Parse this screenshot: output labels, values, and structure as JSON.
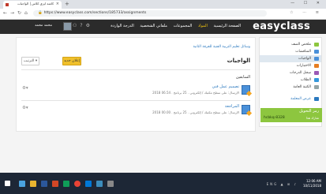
{
  "browser": {
    "tab_title": "كاشة ايزي كلاس | الواجبات",
    "new_tab": "+",
    "tab_close": "×",
    "window_controls": "—  ☐  ✕",
    "nav_back": "←",
    "nav_forward": "→",
    "nav_reload": "↻",
    "nav_home": "⌂",
    "url": "https://www.easyclass.com/sections/185733/assignments",
    "tools": "☆  ⋯  ≡"
  },
  "header": {
    "logo": "easyclass",
    "nav": [
      "الصفحة الرئيسية",
      "المواد",
      "المجموعات",
      "ملفاتي الشخصية",
      "الدرجة الواردة"
    ],
    "active_nav": 1,
    "user_name": "محمد محمد"
  },
  "sidebar": {
    "items": [
      {
        "label": "ملخص الصف",
        "icon": "home-icon",
        "color": "#8dc63f"
      },
      {
        "label": "المناقشات",
        "icon": "chat-icon",
        "color": "#4a90d9"
      },
      {
        "label": "الواجبات",
        "icon": "assignment-icon",
        "color": "#4a90d9"
      },
      {
        "label": "الاختبارات",
        "icon": "quiz-icon",
        "color": "#e67e22"
      },
      {
        "label": "سجل الدرجات",
        "icon": "gradebook-icon",
        "color": "#9b59b6"
      },
      {
        "label": "الطلاب",
        "icon": "students-icon",
        "color": "#3498db"
      },
      {
        "label": "الكتبة العامة",
        "icon": "library-icon",
        "color": "#95a5a6"
      },
      {
        "label": "عرض المعلمة",
        "icon": "teacher-icon",
        "color": "#2b79bf"
      }
    ],
    "code_label": "رمز التحويل",
    "code_value": "hcbkq-8328",
    "code_sub": "شارك هذا"
  },
  "content": {
    "breadcrumb": "وسائل تعليم التربية الفنية للفرقة الثانية",
    "title": "الواجبات",
    "new_button": "إعلان جديد",
    "sort_button": "الترتيب ▾",
    "section_label": "السابقين",
    "assignments": [
      {
        "title": "تصميم عمل فني",
        "meta": "الإرسال: على سطح مكتبك / إلكتروني . 25 برنامج . 06.54 2018"
      },
      {
        "title": "المراجعة",
        "meta": "الإرسال: على سطح مكتبك / إلكتروني . 25 برنامج . 00.00 2018"
      }
    ]
  },
  "taskbar": {
    "tray": "ENG  ▲  ⊞  ♪",
    "time": "12:06 AM",
    "date": "10/11/2018"
  }
}
